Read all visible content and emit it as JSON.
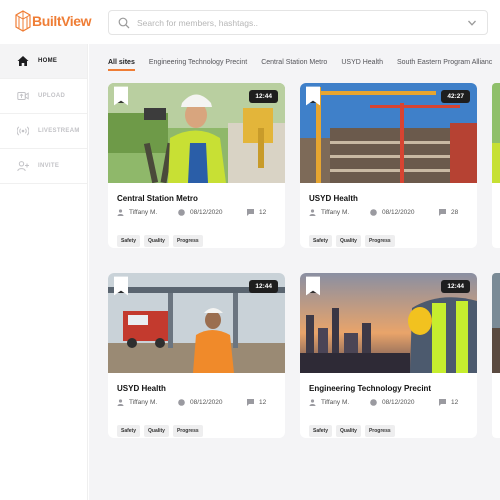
{
  "brand": {
    "name": "BuiltView",
    "color": "#ef7d35"
  },
  "search": {
    "placeholder": "Search for members, hashtags..",
    "value": ""
  },
  "sidebar": {
    "items": [
      {
        "label": "HOME",
        "icon": "home-icon",
        "active": true
      },
      {
        "label": "UPLOAD",
        "icon": "upload-video-icon",
        "active": false
      },
      {
        "label": "LIVESTREAM",
        "icon": "livestream-icon",
        "active": false
      },
      {
        "label": "INVITE",
        "icon": "add-user-icon",
        "active": false
      }
    ]
  },
  "tabs": [
    {
      "label": "All sites",
      "active": true
    },
    {
      "label": "Engineering Technology Precint"
    },
    {
      "label": "Central Station Metro"
    },
    {
      "label": "USYD Health"
    },
    {
      "label": "South Eastern Program Allianc"
    }
  ],
  "cards": [
    {
      "title": "Central Station Metro",
      "duration": "12:44",
      "author": "Tiffany M.",
      "date": "08/12/2020",
      "comments": "12",
      "tags": [
        "Safety",
        "Quality",
        "Progress"
      ]
    },
    {
      "title": "USYD Health",
      "duration": "42:27",
      "author": "Tiffany M.",
      "date": "08/12/2020",
      "comments": "28",
      "tags": [
        "Safety",
        "Quality",
        "Progress"
      ]
    },
    {
      "title": "USYD Health",
      "duration": "12:44",
      "author": "Tiffany M.",
      "date": "08/12/2020",
      "comments": "12",
      "tags": [
        "Safety",
        "Quality",
        "Progress"
      ]
    },
    {
      "title": "Engineering Technology Precint",
      "duration": "12:44",
      "author": "Tiffany M.",
      "date": "08/12/2020",
      "comments": "12",
      "tags": [
        "Safety",
        "Quality",
        "Progress"
      ]
    }
  ]
}
